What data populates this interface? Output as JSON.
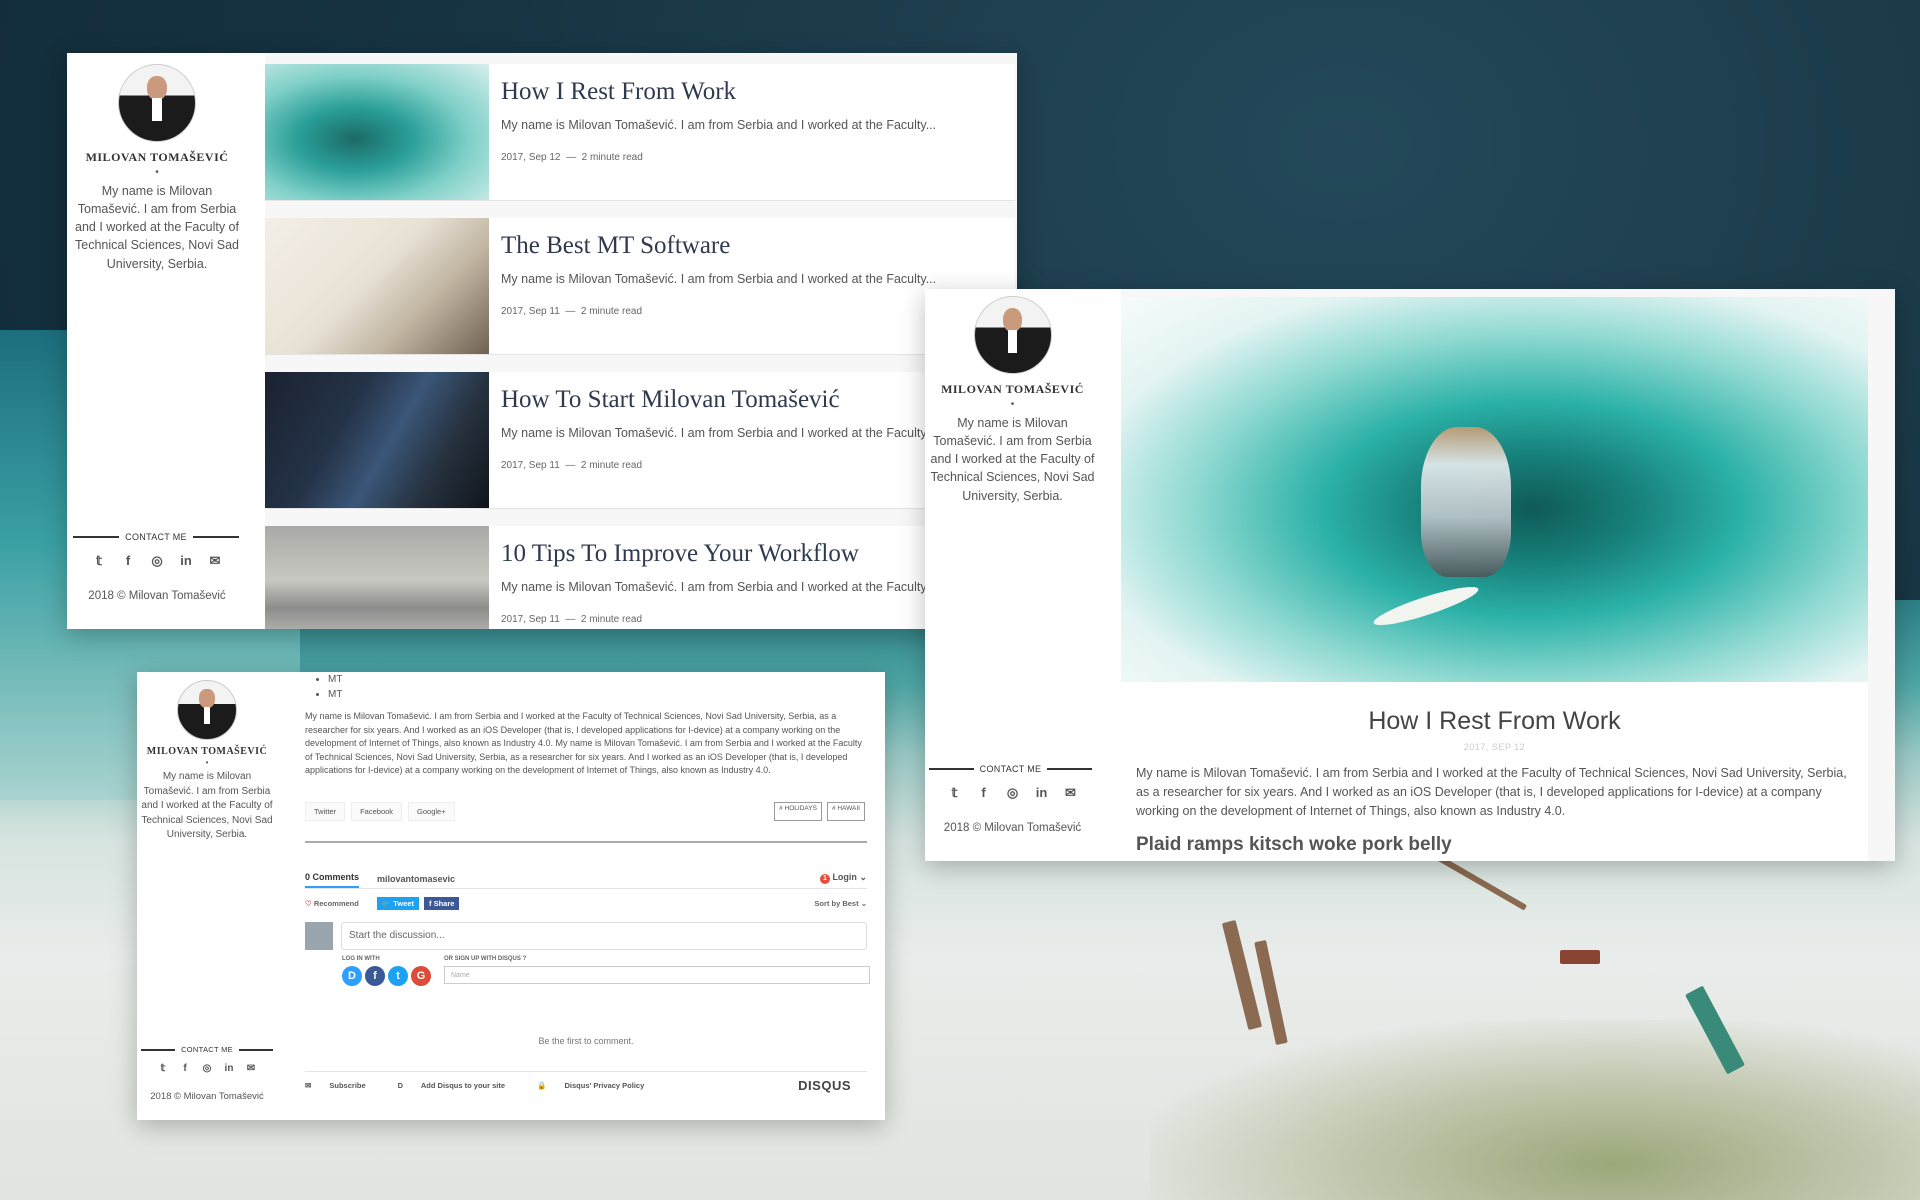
{
  "author": {
    "name": "MILOVAN TOMAŠEVIĆ",
    "dot": "•",
    "bio": "My name is Milovan Tomašević. I am from Serbia and I worked at the Faculty of Technical Sciences, Novi Sad University, Serbia.",
    "contact_label": "CONTACT ME",
    "copyright": "2018 © Milovan Tomašević",
    "socials": [
      {
        "icon": "twitter-icon",
        "glyph": "𝕥"
      },
      {
        "icon": "facebook-icon",
        "glyph": "f"
      },
      {
        "icon": "github-icon",
        "glyph": "◎"
      },
      {
        "icon": "linkedin-icon",
        "glyph": "in"
      },
      {
        "icon": "envelope-icon",
        "glyph": "✉"
      }
    ]
  },
  "feed": {
    "posts": [
      {
        "title": "How I Rest From Work",
        "excerpt": "My name is Milovan Tomašević. I am from Serbia and I worked at the Faculty...",
        "date": "2017, Sep 12",
        "sep": "—",
        "read": "2 minute read"
      },
      {
        "title": "The Best MT Software",
        "excerpt": "My name is Milovan Tomašević. I am from Serbia and I worked at the Faculty...",
        "date": "2017, Sep 11",
        "sep": "—",
        "read": "2 minute read"
      },
      {
        "title": "How To Start Milovan Tomašević",
        "excerpt": "My name is Milovan Tomašević. I am from Serbia and I worked at the Faculty...",
        "date": "2017, Sep 11",
        "sep": "—",
        "read": "2 minute read"
      },
      {
        "title": "10 Tips To Improve Your Workflow",
        "excerpt": "My name is Milovan Tomašević. I am from Serbia and I worked at the Faculty...",
        "date": "2017, Sep 11",
        "sep": "—",
        "read": "2 minute read"
      }
    ]
  },
  "post": {
    "title": "How I Rest From Work",
    "date": "2017, SEP 12",
    "text": "My name is Milovan Tomašević. I am from Serbia and I worked at the Faculty of Technical Sciences, Novi Sad University, Serbia, as a researcher for six years. And I worked as an iOS Developer (that is, I developed applications for I-device) at a company working on the development of Internet of Things, also known as Industry 4.0.",
    "subheading": "Plaid ramps kitsch woke pork belly"
  },
  "comments_page": {
    "list_items": [
      "MT",
      "MT"
    ],
    "text": "My name is Milovan Tomašević. I am from Serbia and I worked at the Faculty of Technical Sciences, Novi Sad University, Serbia, as a researcher for six years. And I worked as an iOS Developer (that is, I developed applications for I-device) at a company working on the development of Internet of Things, also known as Industry 4.0. My name is Milovan Tomašević. I am from Serbia and I worked at the Faculty of Technical Sciences, Novi Sad University, Serbia, as a researcher for six years. And I worked as an iOS Developer (that is, I developed applications for I-device) at a company working on the development of Internet of Things, also known as Industry 4.0.",
    "share": [
      "Twitter",
      "Facebook",
      "Google+"
    ],
    "tags": [
      "# HOLIDAYS",
      "# HAWAII"
    ],
    "disqus": {
      "tab_comments": "0 Comments",
      "tab_site": "milovantomasevic",
      "notif_count": "1",
      "login": "Login",
      "recommend": "Recommend",
      "tweet": "Tweet",
      "share": "Share",
      "sort": "Sort by Best",
      "placeholder": "Start the discussion...",
      "log_in_with": "LOG IN WITH",
      "sign_up": "OR SIGN UP WITH DISQUS",
      "name_placeholder": "Name",
      "providers": [
        {
          "letter": "D",
          "color": "#2e9fff",
          "icon": "disqus-icon"
        },
        {
          "letter": "f",
          "color": "#3b5998",
          "icon": "facebook-icon"
        },
        {
          "letter": "t",
          "color": "#1da1f2",
          "icon": "twitter-icon"
        },
        {
          "letter": "G",
          "color": "#dd4b39",
          "icon": "google-icon"
        }
      ],
      "empty": "Be the first to comment.",
      "subscribe": "Subscribe",
      "add_disqus": "Add Disqus to your site",
      "privacy": "Disqus' Privacy Policy",
      "brand": "DISQUS"
    }
  }
}
